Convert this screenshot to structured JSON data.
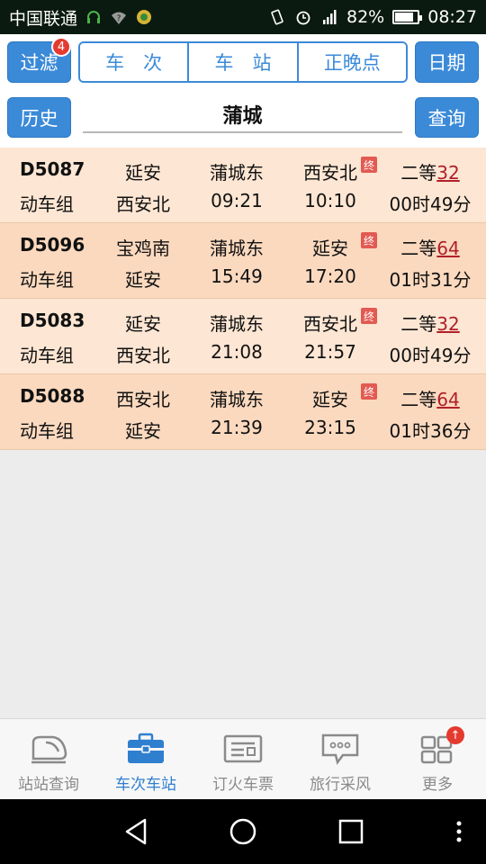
{
  "status_bar": {
    "carrier": "中国联通",
    "battery": "82%",
    "battery_level": 0.82,
    "time": "08:27"
  },
  "header": {
    "filter_label": "过滤",
    "filter_badge": "4",
    "segments": [
      "车　次",
      "车　站",
      "正晚点"
    ],
    "active_segment": 1,
    "date_label": "日期",
    "history_label": "历史",
    "station_value": "蒲城",
    "query_label": "查询"
  },
  "trains": [
    {
      "train": "D5087",
      "type": "动车组",
      "from": "延安",
      "to": "西安北",
      "station": "蒲城东",
      "dep": "09:21",
      "terminal": "西安北",
      "arr": "10:10",
      "term_tag": "终",
      "seat": "二等",
      "count": "32",
      "duration": "00时49分"
    },
    {
      "train": "D5096",
      "type": "动车组",
      "from": "宝鸡南",
      "to": "延安",
      "station": "蒲城东",
      "dep": "15:49",
      "terminal": "延安",
      "arr": "17:20",
      "term_tag": "终",
      "seat": "二等",
      "count": "64",
      "duration": "01时31分"
    },
    {
      "train": "D5083",
      "type": "动车组",
      "from": "延安",
      "to": "西安北",
      "station": "蒲城东",
      "dep": "21:08",
      "terminal": "西安北",
      "arr": "21:57",
      "term_tag": "终",
      "seat": "二等",
      "count": "32",
      "duration": "00时49分"
    },
    {
      "train": "D5088",
      "type": "动车组",
      "from": "西安北",
      "to": "延安",
      "station": "蒲城东",
      "dep": "21:39",
      "terminal": "延安",
      "arr": "23:15",
      "term_tag": "终",
      "seat": "二等",
      "count": "64",
      "duration": "01时36分"
    }
  ],
  "tabs": [
    {
      "label": "站站查询",
      "icon": "train-icon"
    },
    {
      "label": "车次车站",
      "icon": "briefcase-icon"
    },
    {
      "label": "订火车票",
      "icon": "ticket-icon"
    },
    {
      "label": "旅行采风",
      "icon": "chat-bubble-icon"
    },
    {
      "label": "更多",
      "icon": "grid-icon"
    }
  ],
  "active_tab": 1,
  "colors": {
    "accent": "#3b8ad8",
    "row_light": "#fde6d3",
    "row_dark": "#fbd9bf",
    "count": "#b0202a",
    "badge": "#e53a2f"
  }
}
